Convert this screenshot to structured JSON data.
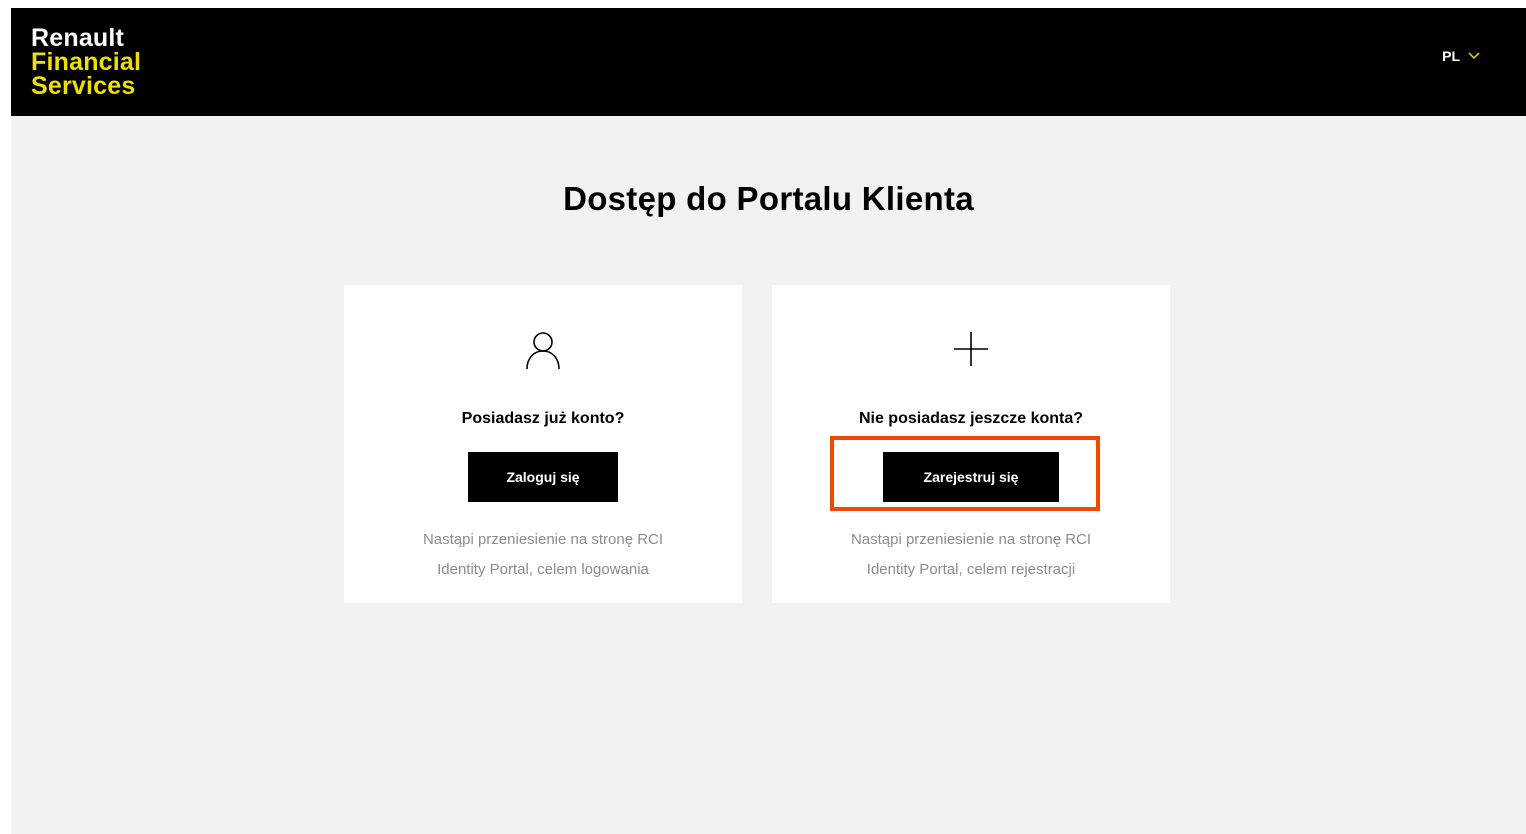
{
  "header": {
    "logo": {
      "line1": "Renault",
      "line2": "Financial",
      "line3": "Services"
    },
    "language": "PL",
    "language_icon": "chevron-down-icon"
  },
  "page_title": "Dostęp do Portalu Klienta",
  "cards": {
    "login": {
      "icon": "user-icon",
      "question": "Posiadasz już konto?",
      "button_label": "Zaloguj się",
      "note_line1": "Nastąpi przeniesienie na stronę RCI",
      "note_line2": "Identity Portal, celem logowania"
    },
    "register": {
      "icon": "plus-icon",
      "question": "Nie posiadasz jeszcze konta?",
      "button_label": "Zarejestruj się",
      "note_line1": "Nastąpi przeniesienie na stronę RCI",
      "note_line2": "Identity Portal, celem rejestracji"
    }
  },
  "colors": {
    "header_bg": "#000000",
    "brand_yellow": "#efdf00",
    "page_bg": "#f2f2f2",
    "highlight": "#f04a00",
    "note_text": "#8c8c8c"
  }
}
